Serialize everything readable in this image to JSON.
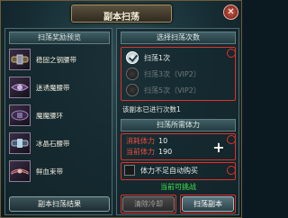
{
  "window": {
    "title": "副本扫荡"
  },
  "rewards": {
    "header": "扫荡奖励预览",
    "items": [
      {
        "name": "稳固之钢腰带",
        "icon": "belt-icon"
      },
      {
        "name": "迷诱魔腰带",
        "icon": "belt-icon"
      },
      {
        "name": "魔魔腰环",
        "icon": "belt-icon"
      },
      {
        "name": "冰晶石腰带",
        "icon": "belt-icon"
      },
      {
        "name": "鲜血束带",
        "icon": "belt-icon"
      }
    ],
    "results_button": "副本扫荡结果"
  },
  "sweep_options": {
    "header": "选择扫荡次数",
    "options": [
      {
        "label": "扫荡1次",
        "selected": true,
        "enabled": true
      },
      {
        "label": "扫荡3次（VIP2）",
        "selected": false,
        "enabled": false
      },
      {
        "label": "扫荡5次（VIP2）",
        "selected": false,
        "enabled": false
      }
    ],
    "remaining_text": "该副本已进行次数1"
  },
  "stamina": {
    "header": "扫荡所需体力",
    "cost_label": "消耗体力",
    "cost_value": "10",
    "current_label": "当前体力",
    "current_value": "190",
    "auto_buy_label": "体力不足自动购买",
    "auto_buy_checked": false,
    "status_text": "当前可挑战"
  },
  "actions": {
    "clear_cooldown": "清除冷却",
    "sweep": "扫荡副本"
  },
  "colors": {
    "highlight_red": "#e0312a",
    "status_green": "#3ee34a",
    "stamina_label_red": "#ef4b3e"
  }
}
